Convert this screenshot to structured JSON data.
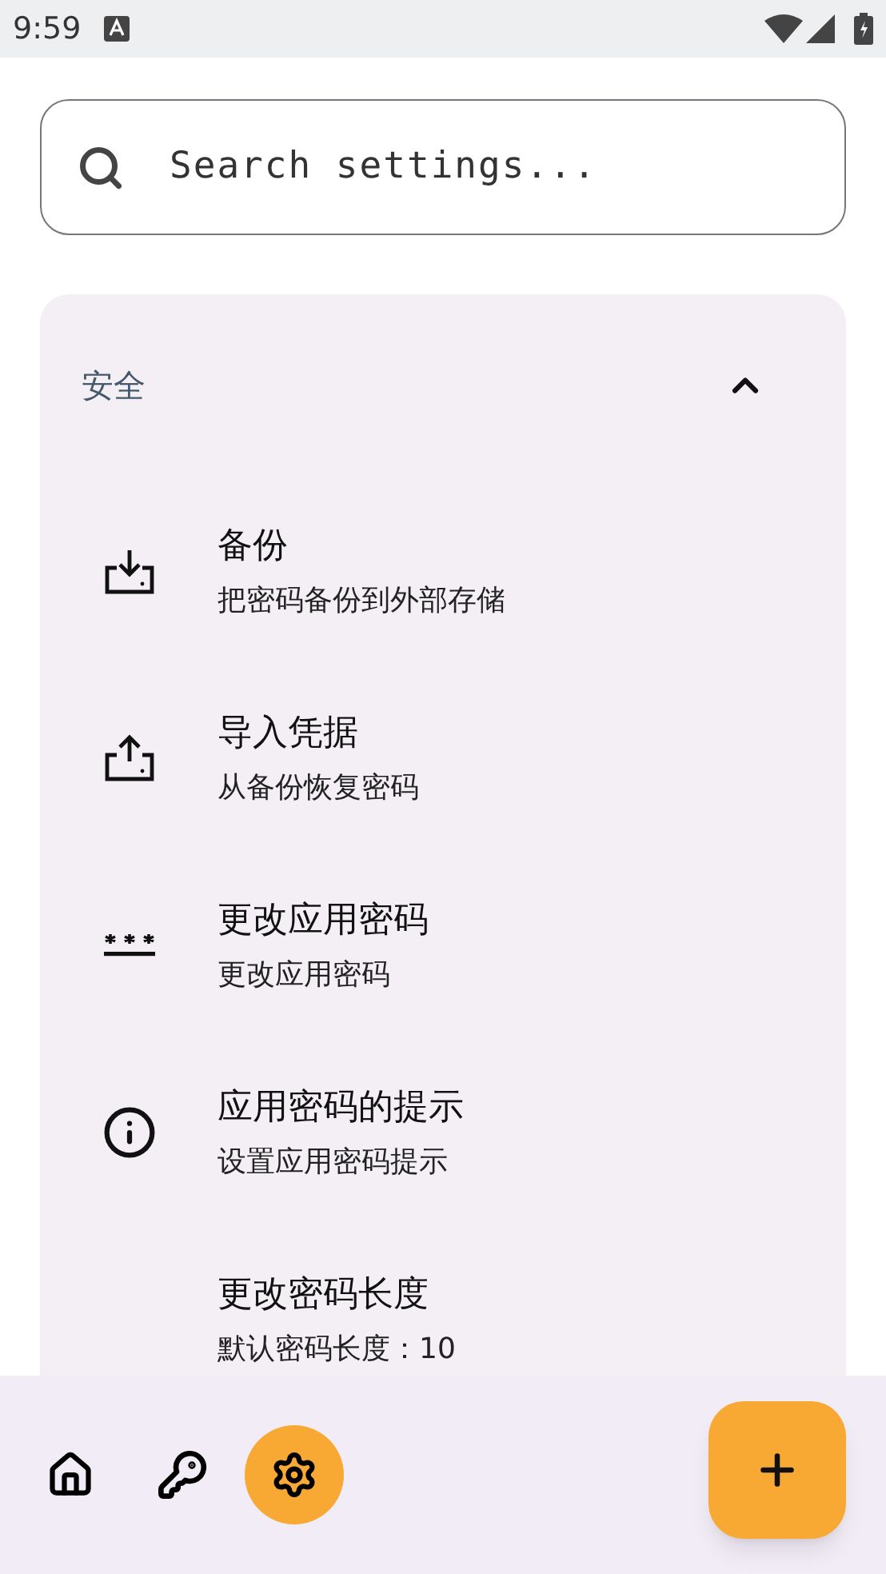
{
  "status_bar": {
    "time": "9:59"
  },
  "search": {
    "placeholder": "Search settings..."
  },
  "section": {
    "title": "安全",
    "expanded": true,
    "items": [
      {
        "kind": "download",
        "title": "备份",
        "subtitle": "把密码备份到外部存储"
      },
      {
        "kind": "upload",
        "title": "导入凭据",
        "subtitle": "从备份恢复密码"
      },
      {
        "kind": "password",
        "title": "更改应用密码",
        "subtitle": "更改应用密码"
      },
      {
        "kind": "info",
        "title": "应用密码的提示",
        "subtitle": "设置应用密码提示"
      },
      {
        "kind": "none",
        "title": "更改密码长度",
        "subtitle": "默认密码长度：10"
      }
    ]
  },
  "nav": [
    {
      "kind": "home",
      "selected": false
    },
    {
      "kind": "key",
      "selected": false
    },
    {
      "kind": "settings",
      "selected": true
    }
  ]
}
